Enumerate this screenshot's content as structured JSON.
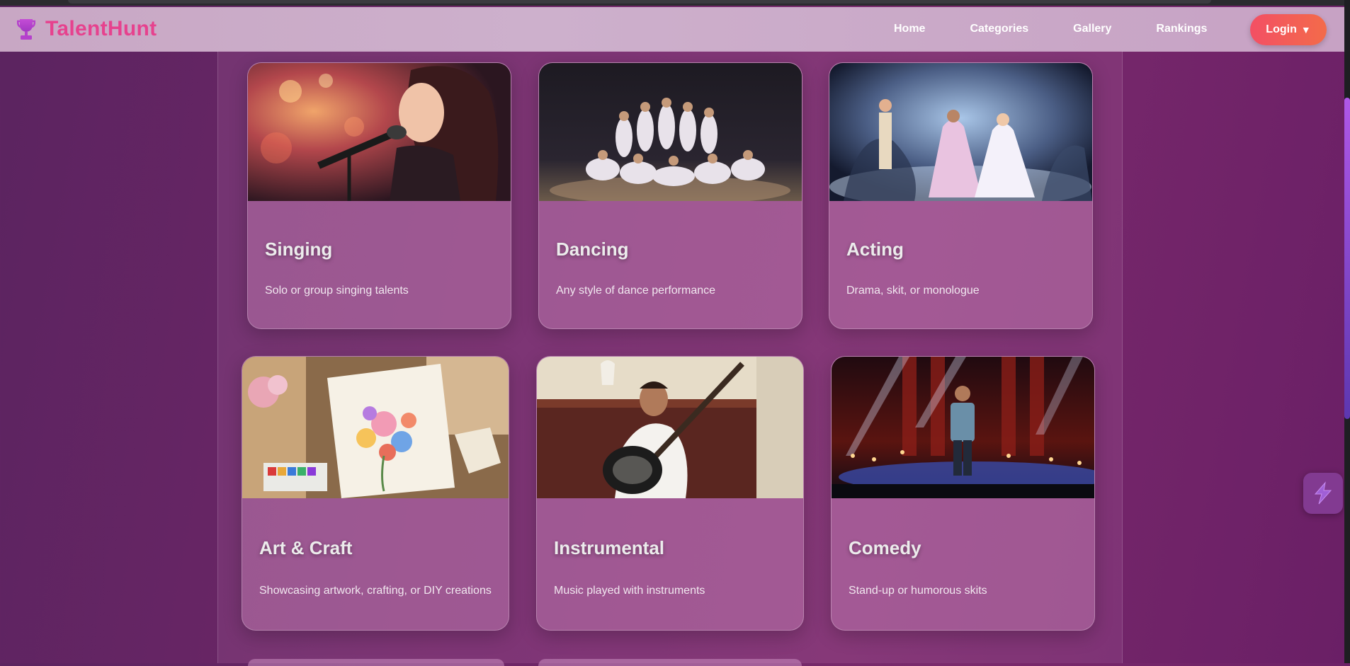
{
  "brand": {
    "name": "TalentHunt",
    "icon": "trophy-icon"
  },
  "nav": {
    "links": [
      "Home",
      "Categories",
      "Gallery",
      "Rankings"
    ],
    "login_label": "Login",
    "login_caret": "▼"
  },
  "categories": [
    {
      "title": "Singing",
      "description": "Solo or group singing talents",
      "image": "singer-with-microphone"
    },
    {
      "title": "Dancing",
      "description": "Any style of dance performance",
      "image": "dance-troupe-on-stage"
    },
    {
      "title": "Acting",
      "description": "Drama, skit, or monologue",
      "image": "theatre-stage-performers"
    },
    {
      "title": "Art & Craft",
      "description": "Showcasing artwork, crafting, or DIY creations",
      "image": "watercolor-painting-supplies"
    },
    {
      "title": "Instrumental",
      "description": "Music played with instruments",
      "image": "sitar-player"
    },
    {
      "title": "Comedy",
      "description": "Stand-up or humorous skits",
      "image": "stand-up-comedian-on-stage"
    }
  ],
  "colors": {
    "brand": "#e6428e",
    "accent": "#f3564f",
    "background": "#6e2667"
  }
}
